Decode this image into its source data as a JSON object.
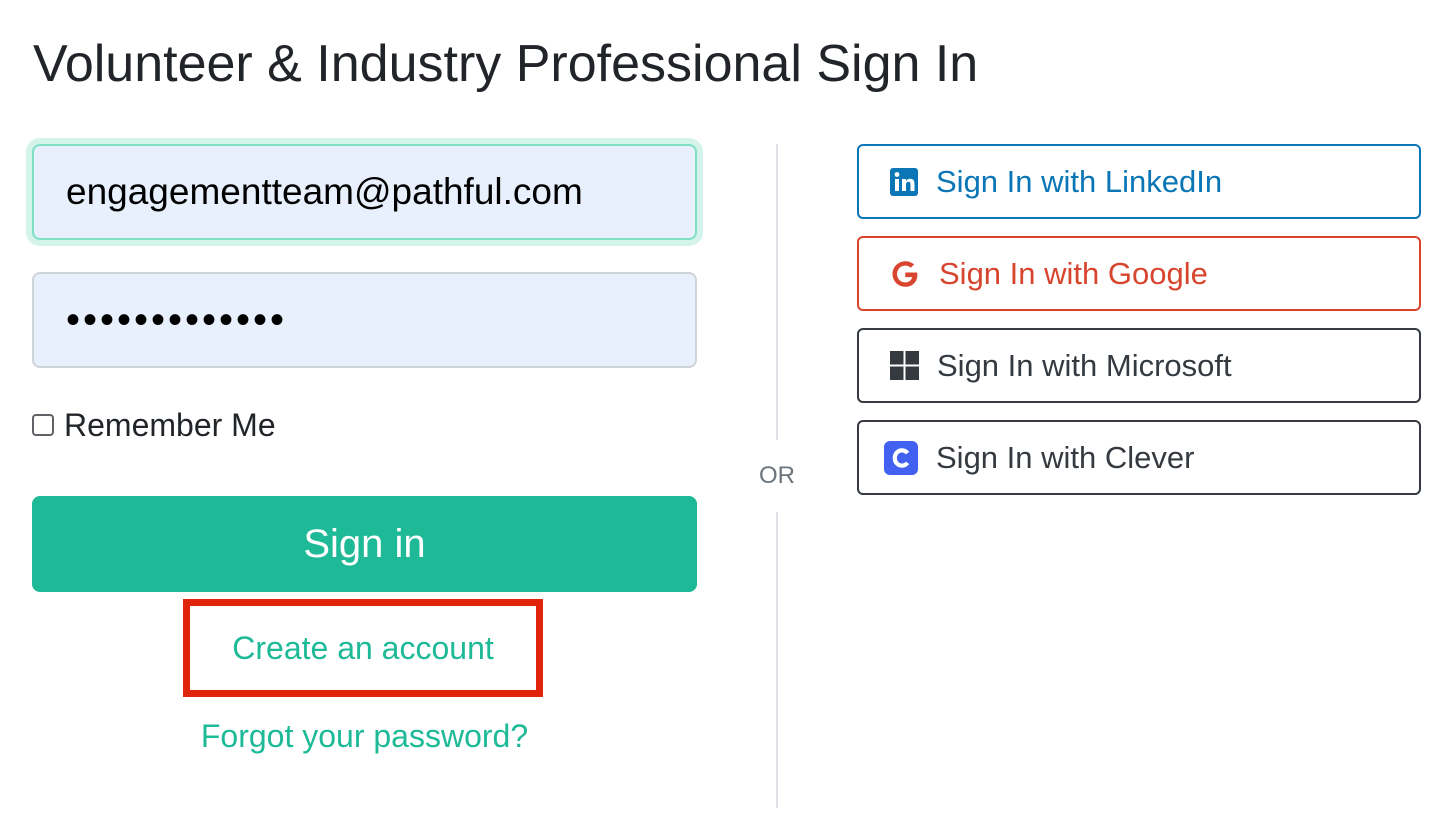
{
  "page": {
    "title": "Volunteer & Industry Professional Sign In"
  },
  "login_form": {
    "email_value": "engagementteam@pathful.com",
    "password_value": "•••••••••••••",
    "remember_label": "Remember Me",
    "remember_checked": false,
    "signin_label": "Sign in",
    "create_account_label": "Create an account",
    "forgot_password_label": "Forgot your password?"
  },
  "divider": {
    "label": "OR"
  },
  "sso": {
    "linkedin": {
      "label": "Sign In with LinkedIn",
      "icon": "linkedin-icon",
      "color": "#0a76b6"
    },
    "google": {
      "label": "Sign In with Google",
      "icon": "google-icon",
      "color": "#d8452f"
    },
    "microsoft": {
      "label": "Sign In with Microsoft",
      "icon": "microsoft-icon",
      "color": "#343a40"
    },
    "clever": {
      "label": "Sign In with Clever",
      "icon": "clever-icon",
      "color": "#343a40"
    }
  },
  "colors": {
    "primary": "#1eba98",
    "highlight_box": "#e0250b",
    "input_bg": "#e8f0fe"
  }
}
